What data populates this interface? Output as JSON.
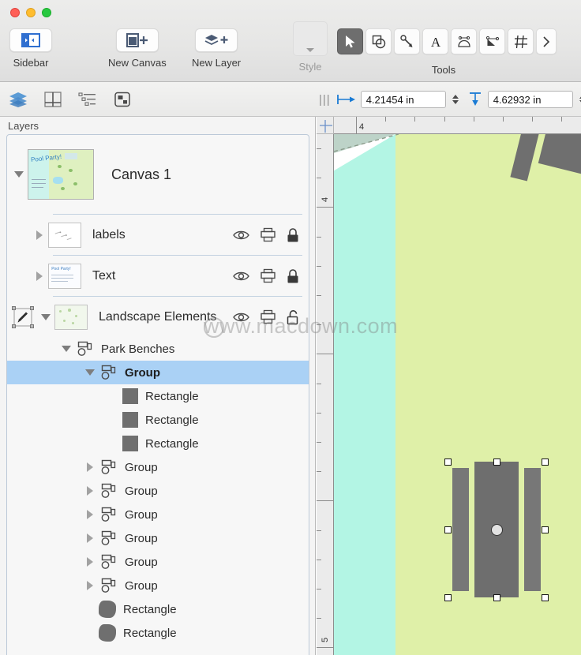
{
  "window": {
    "traffic_lights": [
      "close",
      "minimize",
      "zoom"
    ]
  },
  "toolbar": {
    "items": [
      {
        "label": "Sidebar",
        "icon": "sidebar-icon"
      },
      {
        "label": "New Canvas",
        "icon": "new-canvas-icon"
      },
      {
        "label": "New Layer",
        "icon": "new-layer-icon"
      }
    ],
    "style_label": "Style",
    "tools_label": "Tools",
    "tools": [
      {
        "name": "selection-tool",
        "active": true
      },
      {
        "name": "shape-tool",
        "active": false
      },
      {
        "name": "line-tool",
        "active": false
      },
      {
        "name": "text-tool",
        "active": false
      },
      {
        "name": "pen-tool",
        "active": false
      },
      {
        "name": "bezier-tool",
        "active": false
      },
      {
        "name": "grid-tool",
        "active": false
      },
      {
        "name": "more-tools-chevron",
        "active": false
      }
    ]
  },
  "subbar": {
    "icons": [
      "layers-icon",
      "canvas-split-icon",
      "outline-icon",
      "object-icon"
    ],
    "grip": "|||",
    "x_field": {
      "icon": "horizontal-position-icon",
      "value": "4.21454 in"
    },
    "y_field": {
      "icon": "vertical-position-icon",
      "value": "4.62932 in"
    }
  },
  "panel": {
    "title": "Layers",
    "canvas": {
      "name": "Canvas 1",
      "thumbnail_title": "Pool Party!",
      "expanded": true
    },
    "layers": [
      {
        "name": "labels",
        "expanded": false,
        "controls": [
          "eye-icon",
          "print-icon",
          "lock-icon"
        ]
      },
      {
        "name": "Text",
        "expanded": false,
        "controls": [
          "eye-icon",
          "print-icon",
          "lock-icon"
        ]
      },
      {
        "name": "Landscape Elements",
        "expanded": true,
        "active": true,
        "controls": [
          "eye-icon",
          "print-icon",
          "lock-icon"
        ]
      }
    ],
    "tree": [
      {
        "label": "Park Benches",
        "icon": "group-icon",
        "depth": 1,
        "disclosure": "open",
        "selected": false,
        "bold": false
      },
      {
        "label": "Group",
        "icon": "group-icon",
        "depth": 2,
        "disclosure": "open",
        "selected": true,
        "bold": true
      },
      {
        "label": "Rectangle",
        "icon": "rect-swatch",
        "depth": 3,
        "disclosure": "none",
        "selected": false,
        "bold": false
      },
      {
        "label": "Rectangle",
        "icon": "rect-swatch",
        "depth": 3,
        "disclosure": "none",
        "selected": false,
        "bold": false
      },
      {
        "label": "Rectangle",
        "icon": "rect-swatch",
        "depth": 3,
        "disclosure": "none",
        "selected": false,
        "bold": false
      },
      {
        "label": "Group",
        "icon": "group-icon",
        "depth": 2,
        "disclosure": "closed",
        "selected": false,
        "bold": false
      },
      {
        "label": "Group",
        "icon": "group-icon",
        "depth": 2,
        "disclosure": "closed",
        "selected": false,
        "bold": false
      },
      {
        "label": "Group",
        "icon": "group-icon",
        "depth": 2,
        "disclosure": "closed",
        "selected": false,
        "bold": false
      },
      {
        "label": "Group",
        "icon": "group-icon",
        "depth": 2,
        "disclosure": "closed",
        "selected": false,
        "bold": false
      },
      {
        "label": "Group",
        "icon": "group-icon",
        "depth": 2,
        "disclosure": "closed",
        "selected": false,
        "bold": false
      },
      {
        "label": "Group",
        "icon": "group-icon",
        "depth": 2,
        "disclosure": "closed",
        "selected": false,
        "bold": false
      },
      {
        "label": "Rectangle",
        "icon": "blob-swatch",
        "depth": 2,
        "disclosure": "none",
        "selected": false,
        "bold": false
      },
      {
        "label": "Rectangle",
        "icon": "blob-swatch",
        "depth": 2,
        "disclosure": "none",
        "selected": false,
        "bold": false
      }
    ]
  },
  "canvas_area": {
    "ruler_h_labels": [
      "4"
    ],
    "ruler_v_labels": [
      "4",
      "5"
    ],
    "colors": {
      "water": "#b3f5e4",
      "land": "#dff0a8",
      "shape_gray": "#6f6f6f",
      "selection_accent": "#aad1f5"
    },
    "selected_object": "bench-group"
  },
  "watermark": {
    "text": "www.macdown.com"
  }
}
